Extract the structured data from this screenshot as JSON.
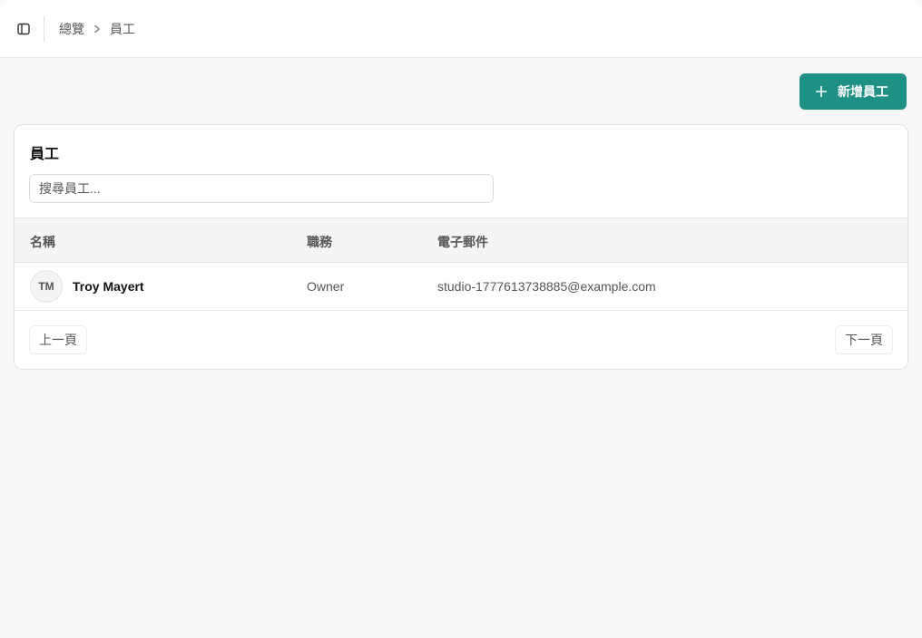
{
  "breadcrumb": {
    "parent": "總覽",
    "current": "員工"
  },
  "toolbar": {
    "add_label": "新增員工"
  },
  "card": {
    "title": "員工",
    "search_placeholder": "搜尋員工..."
  },
  "table": {
    "headers": {
      "name": "名稱",
      "role": "職務",
      "email": "電子郵件"
    },
    "rows": [
      {
        "initials": "TM",
        "name": "Troy Mayert",
        "role": "Owner",
        "email": "studio-1777613738885@example.com"
      }
    ]
  },
  "pagination": {
    "prev_label": "上一頁",
    "next_label": "下一頁"
  },
  "icons": {
    "sidebar_toggle": "sidebar-toggle-icon",
    "breadcrumb_separator": "chevron-right-icon",
    "add": "plus-icon"
  },
  "colors": {
    "accent": "#1f9184",
    "background": "#f7f7f7",
    "card": "#ffffff"
  }
}
